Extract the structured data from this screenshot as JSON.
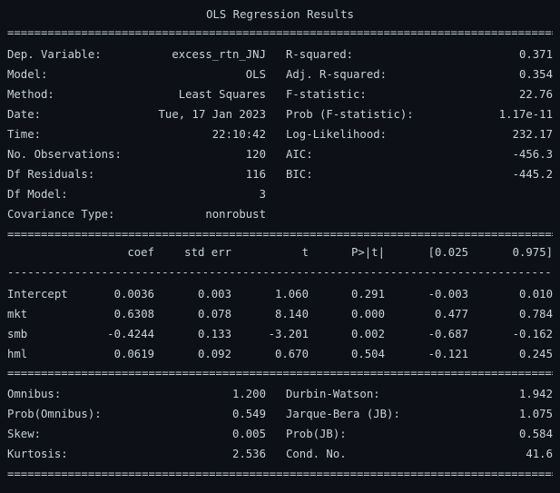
{
  "title": "OLS Regression Results",
  "header_rows": [
    {
      "label1": "Dep. Variable:",
      "value1": "excess_rtn_JNJ",
      "label2": "R-squared:",
      "value2": "0.371"
    },
    {
      "label1": "Model:",
      "value1": "OLS",
      "label2": "Adj. R-squared:",
      "value2": "0.354"
    },
    {
      "label1": "Method:",
      "value1": "Least Squares",
      "label2": "F-statistic:",
      "value2": "22.76"
    },
    {
      "label1": "Date:",
      "value1": "Tue, 17 Jan 2023",
      "label2": "Prob (F-statistic):",
      "value2": "1.17e-11"
    },
    {
      "label1": "Time:",
      "value1": "22:10:42",
      "label2": "Log-Likelihood:",
      "value2": "232.17"
    },
    {
      "label1": "No. Observations:",
      "value1": "120",
      "label2": "AIC:",
      "value2": "-456.3"
    },
    {
      "label1": "Df Residuals:",
      "value1": "116",
      "label2": "BIC:",
      "value2": "-445.2"
    },
    {
      "label1": "Df Model:",
      "value1": "3",
      "label2": "",
      "value2": ""
    },
    {
      "label1": "Covariance Type:",
      "value1": "nonrobust",
      "label2": "",
      "value2": ""
    }
  ],
  "coef_table": {
    "columns": [
      "coef",
      "std err",
      "t",
      "P>|t|",
      "[0.025",
      "0.975]"
    ],
    "rows": [
      {
        "name": "Intercept",
        "values": [
          "0.0036",
          "0.003",
          "1.060",
          "0.291",
          "-0.003",
          "0.010"
        ]
      },
      {
        "name": "mkt",
        "values": [
          "0.6308",
          "0.078",
          "8.140",
          "0.000",
          "0.477",
          "0.784"
        ]
      },
      {
        "name": "smb",
        "values": [
          "-0.4244",
          "0.133",
          "-3.201",
          "0.002",
          "-0.687",
          "-0.162"
        ]
      },
      {
        "name": "hml",
        "values": [
          "0.0619",
          "0.092",
          "0.670",
          "0.504",
          "-0.121",
          "0.245"
        ]
      }
    ]
  },
  "footer_rows": [
    {
      "label1": "Omnibus:",
      "value1": "1.200",
      "label2": "Durbin-Watson:",
      "value2": "1.942"
    },
    {
      "label1": "Prob(Omnibus):",
      "value1": "0.549",
      "label2": "Jarque-Bera (JB):",
      "value2": "1.075"
    },
    {
      "label1": "Skew:",
      "value1": "0.005",
      "label2": "Prob(JB):",
      "value2": "0.584"
    },
    {
      "label1": "Kurtosis:",
      "value1": "2.536",
      "label2": "Cond. No.",
      "value2": "41.6"
    }
  ],
  "colors": {
    "background": "#0d1117",
    "text": "#c9d1d9"
  }
}
